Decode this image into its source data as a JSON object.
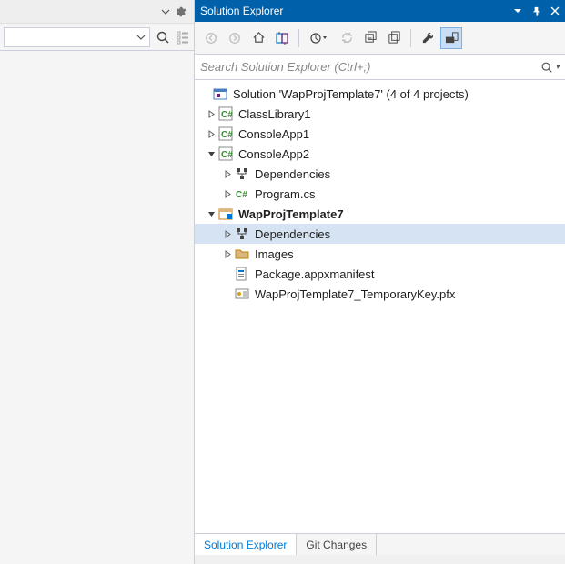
{
  "left": {
    "combo_value": "",
    "tools": {
      "dropdown": "",
      "gear": ""
    }
  },
  "panel": {
    "title": "Solution Explorer"
  },
  "toolbar": {
    "back": "",
    "forward": "",
    "home": "",
    "sync": "",
    "history": "",
    "refresh": "",
    "collapse": "",
    "showall": "",
    "properties": "",
    "preview": ""
  },
  "search": {
    "placeholder": "Search Solution Explorer (Ctrl+;)"
  },
  "tree": {
    "solution": "Solution 'WapProjTemplate7' (4 of 4 projects)",
    "project1": "ClassLibrary1",
    "project2": "ConsoleApp1",
    "project3": "ConsoleApp2",
    "project3_deps": "Dependencies",
    "project3_prog": "Program.cs",
    "project4": "WapProjTemplate7",
    "project4_deps": "Dependencies",
    "project4_images": "Images",
    "project4_manifest": "Package.appxmanifest",
    "project4_key": "WapProjTemplate7_TemporaryKey.pfx"
  },
  "tabs": {
    "solution_explorer": "Solution Explorer",
    "git_changes": "Git Changes"
  }
}
